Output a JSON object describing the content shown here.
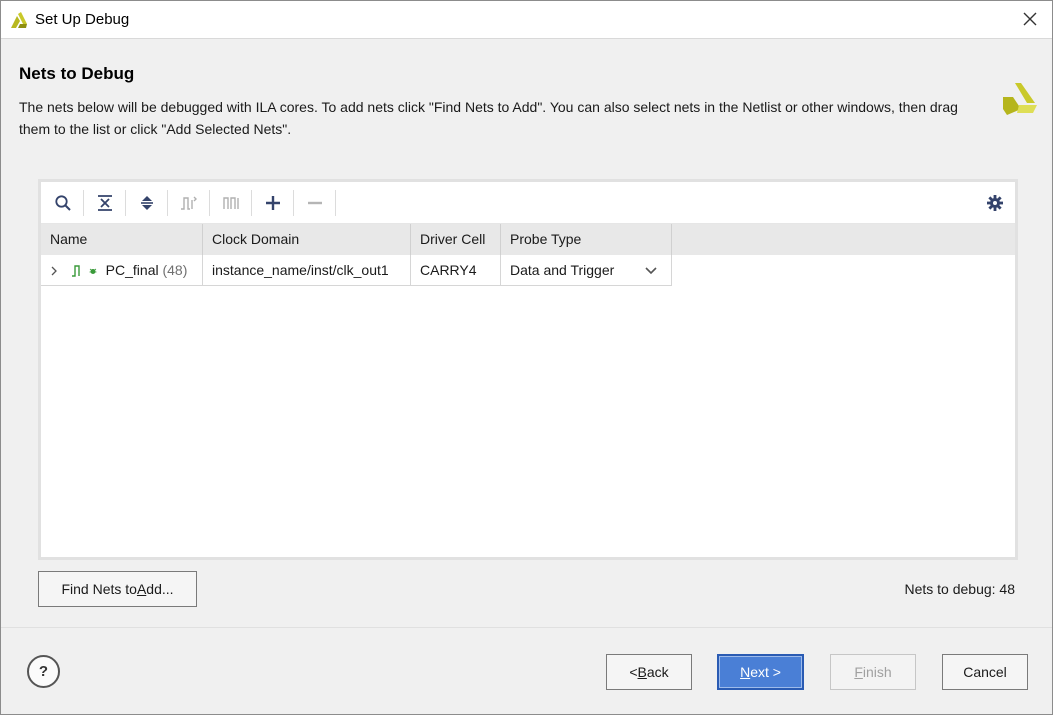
{
  "window": {
    "title": "Set Up Debug"
  },
  "header": {
    "title": "Nets to Debug",
    "description": "The nets below will be debugged with ILA cores. To add nets click \"Find Nets to Add\". You can also select nets in the Netlist or other windows, then drag them to the list or click \"Add Selected Nets\"."
  },
  "toolbar": {
    "icons": [
      "search-icon",
      "collapse-all-icon",
      "expand-all-icon",
      "signal-icon",
      "bus-icon",
      "add-icon",
      "remove-icon",
      "gear-icon"
    ]
  },
  "table": {
    "columns": [
      "Name",
      "Clock Domain",
      "Driver Cell",
      "Probe Type"
    ],
    "rows": [
      {
        "name": "PC_final",
        "count": "(48)",
        "clock_domain": "instance_name/inst/clk_out1",
        "driver_cell": "CARRY4",
        "probe_type": "Data and Trigger"
      }
    ]
  },
  "find_button": {
    "label_pre": "Find Nets to ",
    "label_ul": "A",
    "label_post": "dd..."
  },
  "nets_count": "Nets to debug: 48",
  "footer": {
    "help": "?",
    "back": {
      "pre": "< ",
      "ul": "B",
      "post": "ack"
    },
    "next": {
      "pre": "",
      "ul": "N",
      "post": "ext >"
    },
    "finish": {
      "pre": "",
      "ul": "F",
      "post": "inish"
    },
    "cancel": "Cancel"
  },
  "colors": {
    "accent": "#4a7fd6",
    "brand_yellow": "#c9c92a",
    "icon_navy": "#34436b",
    "signal_green": "#3a9a3a"
  }
}
